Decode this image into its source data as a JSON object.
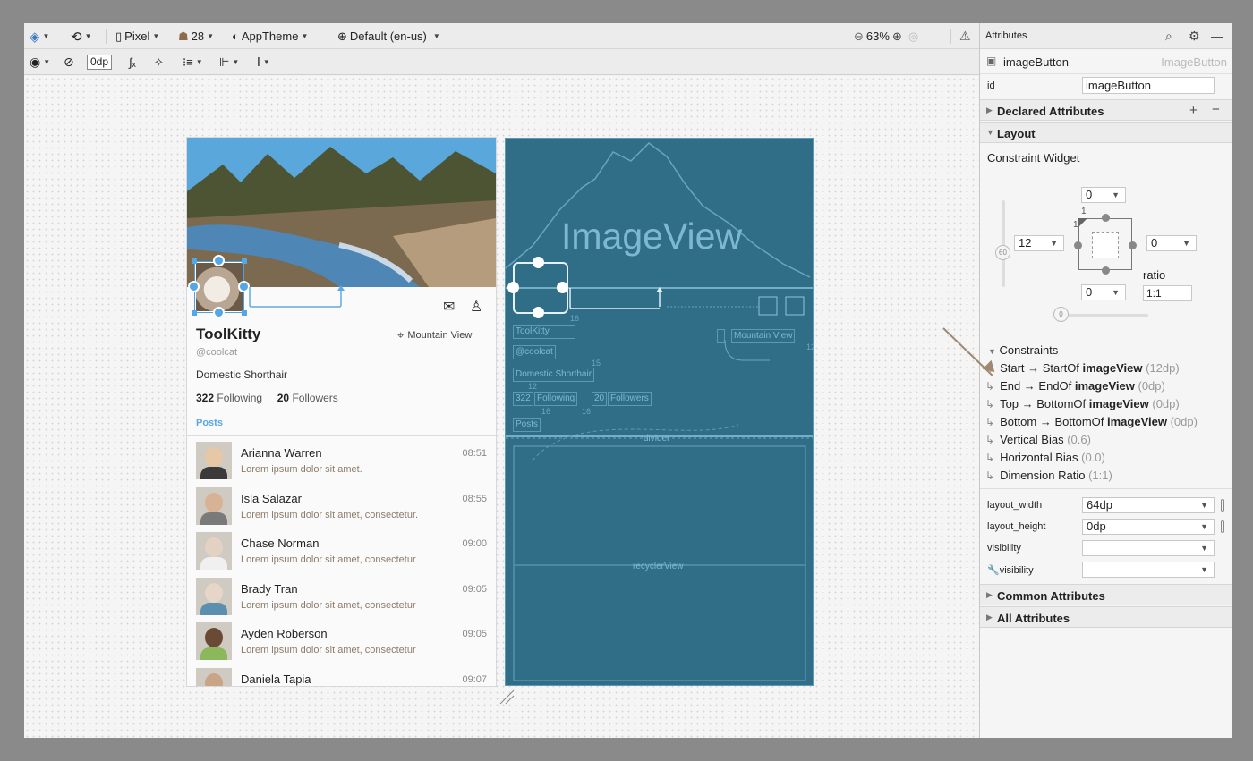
{
  "toolbar": {
    "device": "Pixel",
    "api": "28",
    "theme": "AppTheme",
    "locale": "Default (en-us)",
    "zoom": "63%",
    "margin": "0dp"
  },
  "design": {
    "name": "ToolKitty",
    "handle": "@coolcat",
    "location": "Mountain View",
    "breed": "Domestic Shorthair",
    "following_count": "322",
    "following_label": "Following",
    "followers_count": "20",
    "followers_label": "Followers",
    "posts_label": "Posts",
    "messages": [
      {
        "name": "Arianna Warren",
        "text": "Lorem ipsum dolor sit amet.",
        "time": "08:51",
        "skin": "#e6c7a6",
        "shirt": "#3a3a3a"
      },
      {
        "name": "Isla Salazar",
        "text": "Lorem ipsum dolor sit amet, consectetur.",
        "time": "08:55",
        "skin": "#d8b294",
        "shirt": "#7a7a7a"
      },
      {
        "name": "Chase Norman",
        "text": "Lorem ipsum dolor sit amet, consectetur",
        "time": "09:00",
        "skin": "#e3d2c4",
        "shirt": "#f0f0f0"
      },
      {
        "name": "Brady Tran",
        "text": "Lorem ipsum dolor sit amet, consectetur",
        "time": "09:05",
        "skin": "#e6d6c8",
        "shirt": "#5a8fb0"
      },
      {
        "name": "Ayden Roberson",
        "text": "Lorem ipsum dolor sit amet, consectetur",
        "time": "09:05",
        "skin": "#6a4a34",
        "shirt": "#8ab85a"
      },
      {
        "name": "Daniela Tapia",
        "text": "",
        "time": "09:07",
        "skin": "#c9a487",
        "shirt": "#7a6a5a"
      }
    ]
  },
  "blueprint": {
    "image_view": "ImageView",
    "toolkitty": "ToolKitty",
    "coolcat": "@coolcat",
    "breed": "Domestic Shorthair",
    "following_count": "322",
    "following": "Following",
    "followers_count": "20",
    "followers": "Followers",
    "posts": "Posts",
    "mountain_view": "Mountain View",
    "divider": "divider",
    "recycler": "recyclerView",
    "nums": [
      "16",
      "15",
      "12",
      "16",
      "16",
      "16",
      "12",
      "12"
    ]
  },
  "attributes": {
    "title": "Attributes",
    "component_name": "imageButton",
    "component_type": "ImageButton",
    "id_label": "id",
    "id_value": "imageButton",
    "declared": "Declared Attributes",
    "layout": "Layout",
    "constraint_widget": "Constraint Widget",
    "top_margin": "0",
    "start_margin": "12",
    "end_margin": "0",
    "bottom_margin": "0",
    "ratio_label": "ratio",
    "ratio_value": "1:1",
    "vertical_bias": "60",
    "horizontal_bias": "0",
    "constraints_label": "Constraints",
    "constraints": [
      {
        "prefix": "Start → StartOf ",
        "target": "imageView",
        "value": "(12dp)"
      },
      {
        "prefix": "End → EndOf ",
        "target": "imageView",
        "value": "(0dp)"
      },
      {
        "prefix": "Top → BottomOf ",
        "target": "imageView",
        "value": "(0dp)"
      },
      {
        "prefix": "Bottom → BottomOf ",
        "target": "imageView",
        "value": "(0dp)"
      },
      {
        "prefix": "Vertical Bias ",
        "target": "",
        "value": "(0.6)"
      },
      {
        "prefix": "Horizontal Bias ",
        "target": "",
        "value": "(0.0)"
      },
      {
        "prefix": "Dimension Ratio ",
        "target": "",
        "value": "(1:1)"
      }
    ],
    "layout_width_label": "layout_width",
    "layout_width_value": "64dp",
    "layout_height_label": "layout_height",
    "layout_height_value": "0dp",
    "visibility_label": "visibility",
    "tools_visibility_label": "visibility",
    "common": "Common Attributes",
    "all": "All Attributes"
  }
}
